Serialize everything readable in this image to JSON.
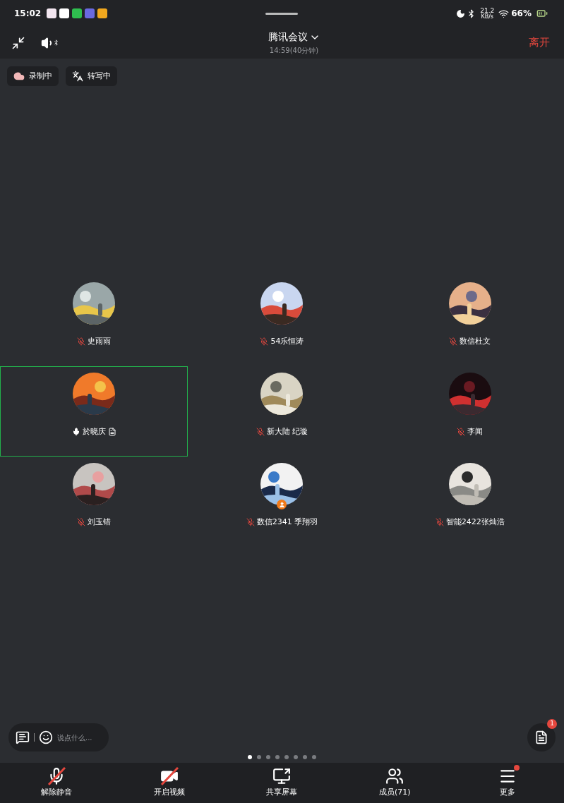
{
  "status_bar": {
    "time": "15:02",
    "net_speed": "21.2",
    "net_unit": "KB/s",
    "battery": "66%"
  },
  "header": {
    "title": "腾讯会议",
    "subtitle": "14:59(40分钟)",
    "leave": "离开"
  },
  "chips": [
    {
      "label": "录制中",
      "kind": "record"
    },
    {
      "label": "转写中",
      "kind": "transcribe"
    }
  ],
  "participants": [
    {
      "name": "史雨雨",
      "muted": true,
      "selected": false,
      "host": false,
      "note": false
    },
    {
      "name": "54乐恒涛",
      "muted": true,
      "selected": false,
      "host": false,
      "note": false
    },
    {
      "name": "数信杜文",
      "muted": true,
      "selected": false,
      "host": false,
      "note": false
    },
    {
      "name": "於晓庆",
      "muted": false,
      "selected": true,
      "host": false,
      "note": true
    },
    {
      "name": "新大陆 纪璇",
      "muted": true,
      "selected": false,
      "host": false,
      "note": false
    },
    {
      "name": "李闻",
      "muted": true,
      "selected": false,
      "host": false,
      "note": false
    },
    {
      "name": "刘玉错",
      "muted": true,
      "selected": false,
      "host": false,
      "note": false
    },
    {
      "name": "数信2341 季翔羽",
      "muted": true,
      "selected": false,
      "host": true,
      "note": false
    },
    {
      "name": "智能2422张灿浩",
      "muted": true,
      "selected": false,
      "host": false,
      "note": false
    }
  ],
  "chat": {
    "placeholder": "说点什么...",
    "badge": "1"
  },
  "pages": [
    {
      "selected": true
    },
    {
      "selected": false
    },
    {
      "selected": false
    },
    {
      "selected": false
    },
    {
      "selected": false
    },
    {
      "selected": false
    },
    {
      "selected": false
    },
    {
      "selected": false
    }
  ],
  "toolbar": [
    {
      "kind": "mic",
      "label": "解除静音",
      "off": true,
      "dot": false
    },
    {
      "kind": "video",
      "label": "开启视频",
      "off": true,
      "dot": false
    },
    {
      "kind": "share",
      "label": "共享屏幕",
      "off": false,
      "dot": false
    },
    {
      "kind": "members",
      "label": "成员(71)",
      "off": false,
      "dot": false
    },
    {
      "kind": "more",
      "label": "更多",
      "off": false,
      "dot": true
    }
  ]
}
